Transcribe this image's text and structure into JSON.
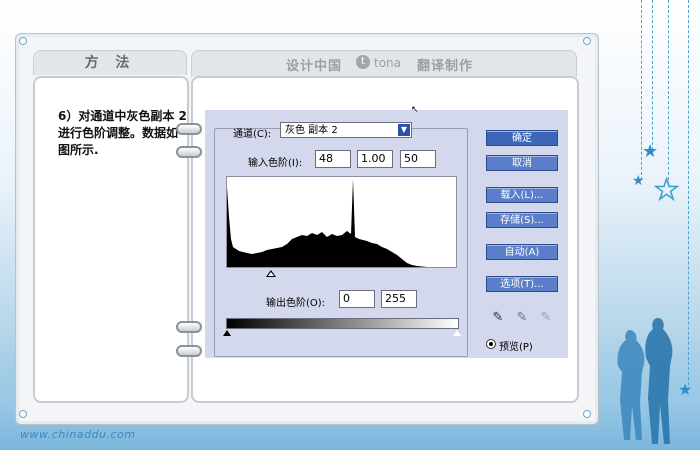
{
  "site_url": "www.chinaddu.com",
  "left_tab": {
    "title": "方 法"
  },
  "step": {
    "text": "6）对通道中灰色副本 2 进行色阶调整。数据如图所示."
  },
  "header": {
    "part1": "设计中国",
    "logo_letter": "t",
    "brand": "tona",
    "part2": "翻译制作"
  },
  "dialog": {
    "channel_label": "通道(C):",
    "channel_value": "灰色 副本 2",
    "input_levels_label": "输入色阶(I):",
    "input_levels": [
      "48",
      "1.00",
      "50"
    ],
    "output_levels_label": "输出色阶(O):",
    "output_levels": [
      "0",
      "255"
    ],
    "buttons": {
      "ok": "确定",
      "cancel": "取消",
      "load": "载入(L)...",
      "save": "存储(S)...",
      "auto": "自动(A)",
      "options": "选项(T)..."
    },
    "preview_label": "预览(P)",
    "preview_checked": true
  },
  "colors": {
    "accent": "#3e66b8",
    "dialog_bg": "#d4d8ec",
    "star": "#2b8fc4"
  }
}
